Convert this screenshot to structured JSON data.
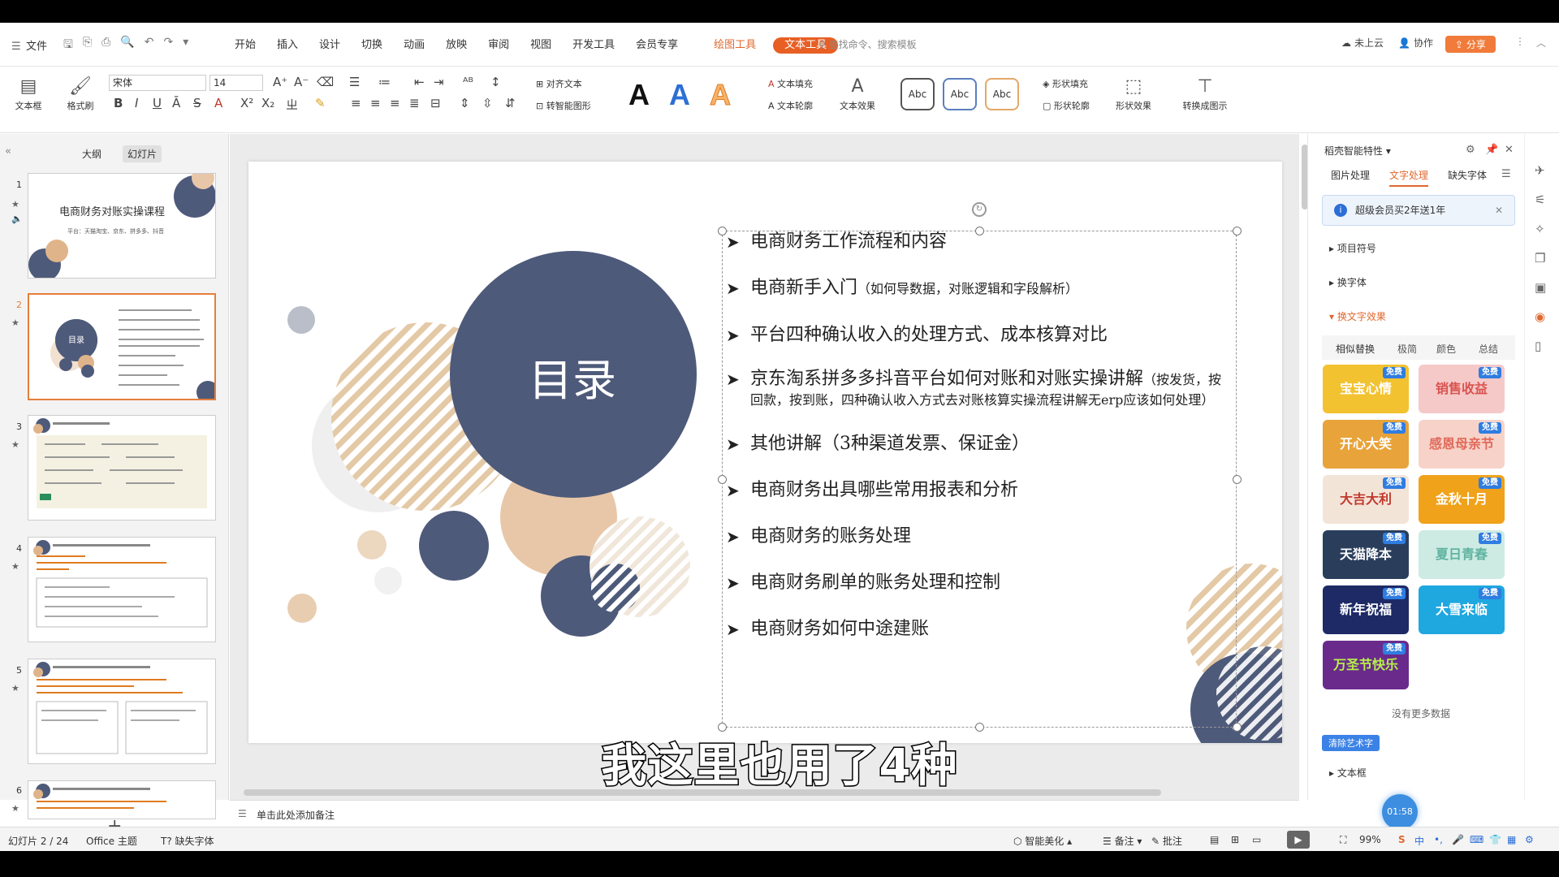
{
  "menu": {
    "file": "文件",
    "tabs": [
      "开始",
      "插入",
      "设计",
      "切换",
      "动画",
      "放映",
      "审阅",
      "视图",
      "开发工具",
      "会员专享"
    ],
    "context_tabs": {
      "drawing": "绘图工具",
      "text": "文本工具"
    },
    "search_placeholder": "查找命令、搜索模板",
    "cloud": "未上云",
    "collab": "协作",
    "share": "分享"
  },
  "ribbon": {
    "textbox": "文本框",
    "format_painter": "格式刷",
    "font_name": "宋体",
    "font_size": "14",
    "align_text": "对齐文本",
    "smart_shape": "转智能图形",
    "text_fill": "文本填充",
    "text_outline": "文本轮廓",
    "text_effect": "文本效果",
    "shape_fill": "形状填充",
    "shape_outline": "形状轮廓",
    "shape_effect": "形状效果",
    "convert_graphic": "转换成图示",
    "abc": "Abc",
    "big_a": "A"
  },
  "left_panel": {
    "tabs": [
      "大纲",
      "幻灯片"
    ],
    "active_tab": "幻灯片",
    "thumb1_title": "电商财务对账实操课程",
    "thumb1_sub": "平台：天猫淘宝、京东、拼多多、抖音",
    "thumb2_title": "目录",
    "slide_numbers": [
      "1",
      "2",
      "3",
      "4",
      "5",
      "6"
    ]
  },
  "slide": {
    "title": "目录",
    "items": [
      {
        "text": "电商财务工作流程和内容",
        "note": ""
      },
      {
        "text": "电商新手入门",
        "note": "（如何导数据，对账逻辑和字段解析）"
      },
      {
        "text": "平台四种确认收入的处理方式、成本核算对比",
        "note": ""
      },
      {
        "text": "京东淘系拼多多抖音平台如何对账和对账实操讲解",
        "note": "（按发货，按回款，按到账，四种确认收入方式去对账核算实操流程讲解无erp应该如何处理）"
      },
      {
        "text": "其他讲解（3种渠道发票、保证金）",
        "note": ""
      },
      {
        "text": "电商财务出具哪些常用报表和分析",
        "note": ""
      },
      {
        "text": "电商财务的账务处理",
        "note": ""
      },
      {
        "text": "电商财务刷单的账务处理和控制",
        "note": ""
      },
      {
        "text": "电商财务如何中途建账",
        "note": ""
      }
    ]
  },
  "right_panel": {
    "title": "稻壳智能特性",
    "tabs": [
      "图片处理",
      "文字处理",
      "缺失字体"
    ],
    "active_tab": "文字处理",
    "promo": "超级会员买2年送1年",
    "sections": [
      "项目符号",
      "换字体",
      "换文字效果",
      "文本框"
    ],
    "sub_tabs": [
      "相似替换",
      "极简",
      "颜色",
      "总结"
    ],
    "free_badge": "免费",
    "tiles": [
      {
        "label": "宝宝心情",
        "color": "#f2c230"
      },
      {
        "label": "销售收益",
        "color": "#f6c9c9"
      },
      {
        "label": "开心大笑",
        "color": "#e8a33a"
      },
      {
        "label": "感恩母亲节",
        "color": "#f7d2c9"
      },
      {
        "label": "大吉大利",
        "color": "#f3e4d8"
      },
      {
        "label": "金秋十月",
        "color": "#f0a21b"
      },
      {
        "label": "天猫降本",
        "color": "#2a3e5c"
      },
      {
        "label": "夏日青春",
        "color": "#cdebe3"
      },
      {
        "label": "新年祝福",
        "color": "#1e2a66"
      },
      {
        "label": "大雪来临",
        "color": "#1fa7e0"
      },
      {
        "label": "万圣节快乐",
        "color": "#6a2a8c"
      }
    ],
    "no_more": "没有更多数据",
    "clear_art": "清除艺术字",
    "timer": "01:58"
  },
  "notes": {
    "placeholder": "单击此处添加备注"
  },
  "status": {
    "slide_info": "幻灯片 2 / 24",
    "theme": "Office 主题",
    "missing_font": "缺失字体",
    "smart_beautify": "智能美化",
    "notes": "备注",
    "comments": "批注",
    "zoom": "99%",
    "ime": "中"
  },
  "subtitle": "我这里也用了4种"
}
